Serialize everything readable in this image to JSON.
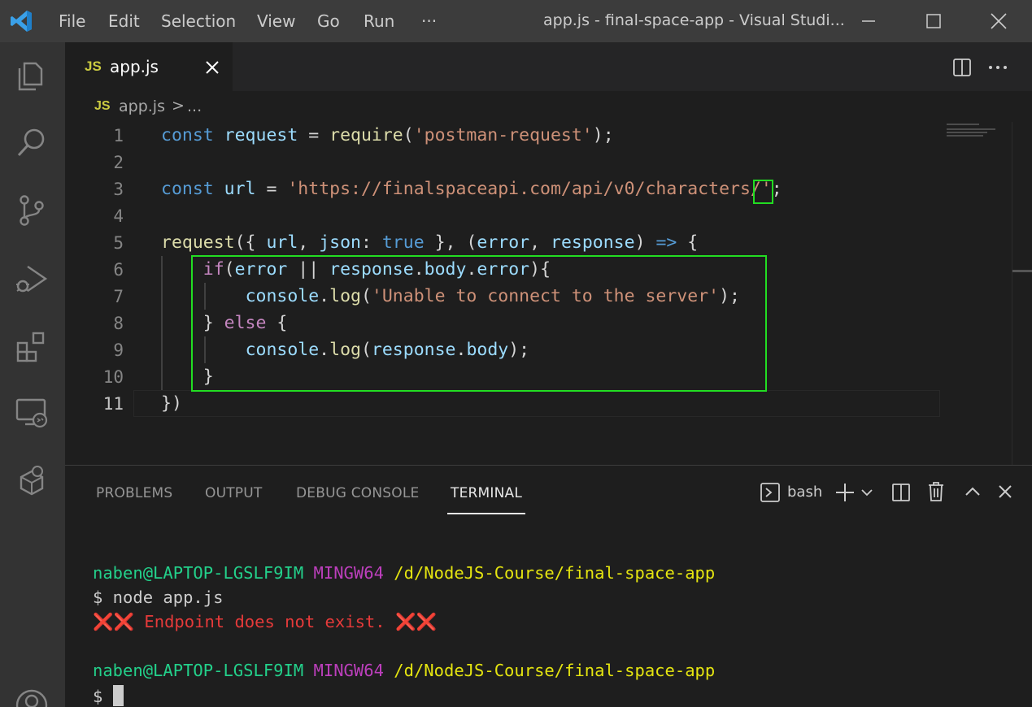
{
  "titlebar": {
    "menu": [
      "File",
      "Edit",
      "Selection",
      "View",
      "Go",
      "Run",
      "···"
    ],
    "title": "app.js - final-space-app - Visual Studi..."
  },
  "activity_icons": [
    "explorer-icon",
    "search-icon",
    "source-control-icon",
    "run-debug-icon",
    "extensions-icon",
    "remote-explorer-icon",
    "docker-icon",
    "account-icon"
  ],
  "tab": {
    "badge": "JS",
    "name": "app.js"
  },
  "breadcrumb": {
    "badge": "JS",
    "file": "app.js",
    "sep": ">",
    "more": "..."
  },
  "editor": {
    "line_numbers": [
      "1",
      "2",
      "3",
      "4",
      "5",
      "6",
      "7",
      "8",
      "9",
      "10",
      "11"
    ],
    "current_line": "11",
    "lines": [
      [
        {
          "t": "const ",
          "c": "kw"
        },
        {
          "t": "request",
          "c": "var"
        },
        {
          "t": " = ",
          "c": "plain"
        },
        {
          "t": "require",
          "c": "fn"
        },
        {
          "t": "(",
          "c": "plain"
        },
        {
          "t": "'postman-request'",
          "c": "str"
        },
        {
          "t": ");",
          "c": "plain"
        }
      ],
      [],
      [
        {
          "t": "const ",
          "c": "kw"
        },
        {
          "t": "url",
          "c": "var"
        },
        {
          "t": " = ",
          "c": "plain"
        },
        {
          "t": "'https://finalspaceapi.com/api/v0/characters/'",
          "c": "str"
        },
        {
          "t": ";",
          "c": "plain"
        }
      ],
      [],
      [
        {
          "t": "request",
          "c": "fn"
        },
        {
          "t": "({ ",
          "c": "plain"
        },
        {
          "t": "url",
          "c": "var"
        },
        {
          "t": ", ",
          "c": "plain"
        },
        {
          "t": "json",
          "c": "var"
        },
        {
          "t": ": ",
          "c": "plain"
        },
        {
          "t": "true",
          "c": "kw"
        },
        {
          "t": " }, (",
          "c": "plain"
        },
        {
          "t": "error",
          "c": "var"
        },
        {
          "t": ", ",
          "c": "plain"
        },
        {
          "t": "response",
          "c": "var"
        },
        {
          "t": ") ",
          "c": "plain"
        },
        {
          "t": "=>",
          "c": "kw"
        },
        {
          "t": " {",
          "c": "plain"
        }
      ],
      [
        {
          "t": "    ",
          "c": "plain"
        },
        {
          "t": "if",
          "c": "ctl"
        },
        {
          "t": "(",
          "c": "plain"
        },
        {
          "t": "error",
          "c": "var"
        },
        {
          "t": " || ",
          "c": "plain"
        },
        {
          "t": "response",
          "c": "var"
        },
        {
          "t": ".",
          "c": "plain"
        },
        {
          "t": "body",
          "c": "var"
        },
        {
          "t": ".",
          "c": "plain"
        },
        {
          "t": "error",
          "c": "var"
        },
        {
          "t": "){",
          "c": "plain"
        }
      ],
      [
        {
          "t": "        ",
          "c": "plain"
        },
        {
          "t": "console",
          "c": "var"
        },
        {
          "t": ".",
          "c": "plain"
        },
        {
          "t": "log",
          "c": "fn"
        },
        {
          "t": "(",
          "c": "plain"
        },
        {
          "t": "'Unable to connect to the server'",
          "c": "str"
        },
        {
          "t": ");",
          "c": "plain"
        }
      ],
      [
        {
          "t": "    ",
          "c": "plain"
        },
        {
          "t": "} ",
          "c": "plain"
        },
        {
          "t": "else",
          "c": "ctl"
        },
        {
          "t": " {",
          "c": "plain"
        }
      ],
      [
        {
          "t": "        ",
          "c": "plain"
        },
        {
          "t": "console",
          "c": "var"
        },
        {
          "t": ".",
          "c": "plain"
        },
        {
          "t": "log",
          "c": "fn"
        },
        {
          "t": "(",
          "c": "plain"
        },
        {
          "t": "response",
          "c": "var"
        },
        {
          "t": ".",
          "c": "plain"
        },
        {
          "t": "body",
          "c": "var"
        },
        {
          "t": ");",
          "c": "plain"
        }
      ],
      [
        {
          "t": "    ",
          "c": "plain"
        },
        {
          "t": "}",
          "c": "plain"
        }
      ],
      [
        {
          "t": "})",
          "c": "plain"
        }
      ]
    ]
  },
  "panel": {
    "tabs": [
      "PROBLEMS",
      "OUTPUT",
      "DEBUG CONSOLE",
      "TERMINAL"
    ],
    "active_tab": "TERMINAL",
    "shell": "bash",
    "terminal": [
      {
        "user": "naben@LAPTOP-LGSLF9IM",
        "env": "MINGW64",
        "path": "/d/NodeJS-Course/final-space-app"
      },
      {
        "prompt": "$ node app.js"
      },
      {
        "output": "❌❌ Endpoint does not exist. ❌❌"
      },
      {
        "user": "naben@LAPTOP-LGSLF9IM",
        "env": "MINGW64",
        "path": "/d/NodeJS-Course/final-space-app"
      },
      {
        "prompt": "$ "
      }
    ]
  },
  "colors": {
    "accent_highlight": "#22dd22",
    "titlebar": "#3c3c3c",
    "activitybar": "#333333",
    "editor_bg": "#1e1e1e"
  }
}
